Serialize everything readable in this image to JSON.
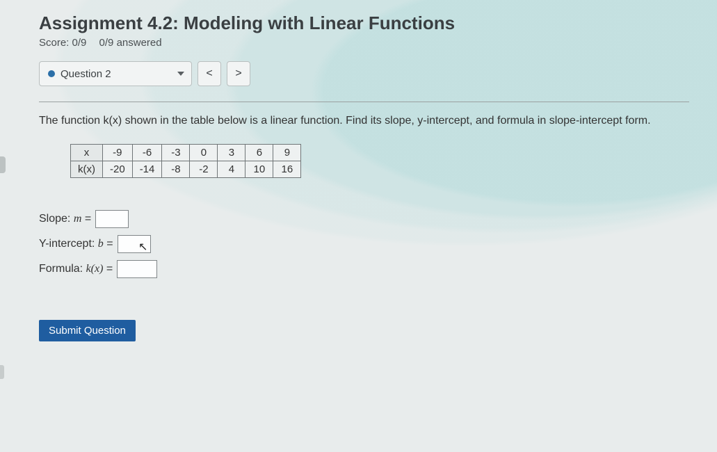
{
  "header": {
    "title": "Assignment 4.2: Modeling with Linear Functions",
    "score_label": "Score: 0/9",
    "answered_label": "0/9 answered"
  },
  "nav": {
    "question_label": "Question 2",
    "prev": "<",
    "next": ">"
  },
  "prompt": "The function k(x) shown in the table below is a linear function. Find its slope, y-intercept, and formula in slope-intercept form.",
  "table": {
    "row_labels": [
      "x",
      "k(x)"
    ],
    "x": [
      "-9",
      "-6",
      "-3",
      "0",
      "3",
      "6",
      "9"
    ],
    "kx": [
      "-20",
      "-14",
      "-8",
      "-2",
      "4",
      "10",
      "16"
    ]
  },
  "answers": {
    "slope_label": "Slope: ",
    "slope_var": "m",
    "slope_value": "",
    "yint_label": "Y-intercept: ",
    "yint_var": "b",
    "yint_value": "",
    "formula_label": "Formula: ",
    "formula_lhs": "k(x)",
    "formula_value": ""
  },
  "submit_label": "Submit Question"
}
